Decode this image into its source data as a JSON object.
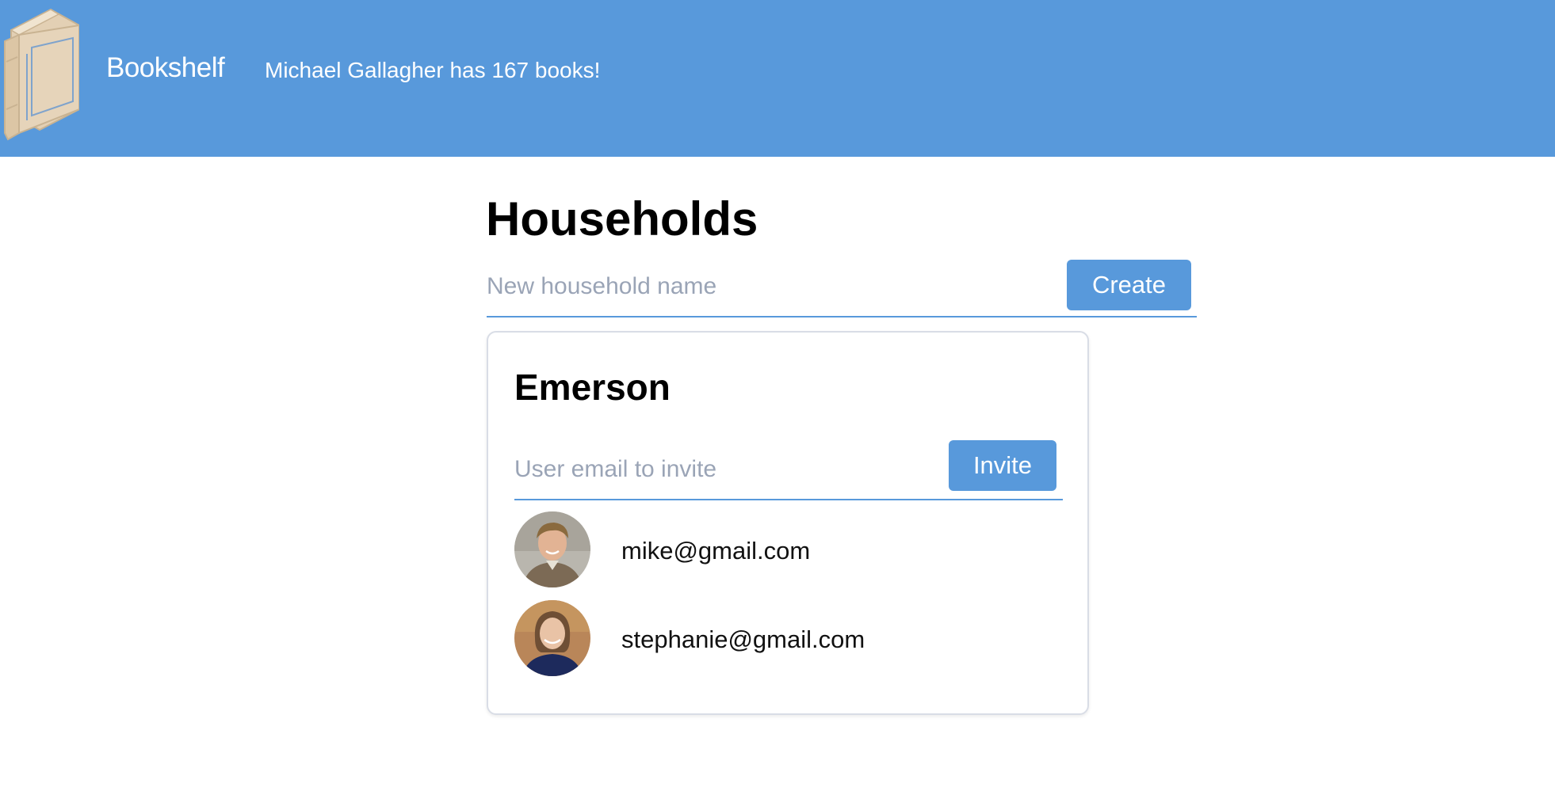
{
  "header": {
    "brand": "Bookshelf",
    "tagline": "Michael Gallagher has 167 books!",
    "logo_icon": "book-icon",
    "background_color": "#5899db"
  },
  "main": {
    "title": "Households",
    "new_household": {
      "placeholder": "New household name",
      "value": "",
      "button_label": "Create"
    },
    "households": [
      {
        "name": "Emerson",
        "invite": {
          "placeholder": "User email to invite",
          "value": "",
          "button_label": "Invite"
        },
        "members": [
          {
            "email": "mike@gmail.com",
            "avatar_icon": "user-avatar"
          },
          {
            "email": "stephanie@gmail.com",
            "avatar_icon": "user-avatar"
          }
        ]
      }
    ]
  },
  "colors": {
    "accent": "#5899db",
    "placeholder": "#9aa4b6",
    "card_border": "#d9dde6"
  }
}
